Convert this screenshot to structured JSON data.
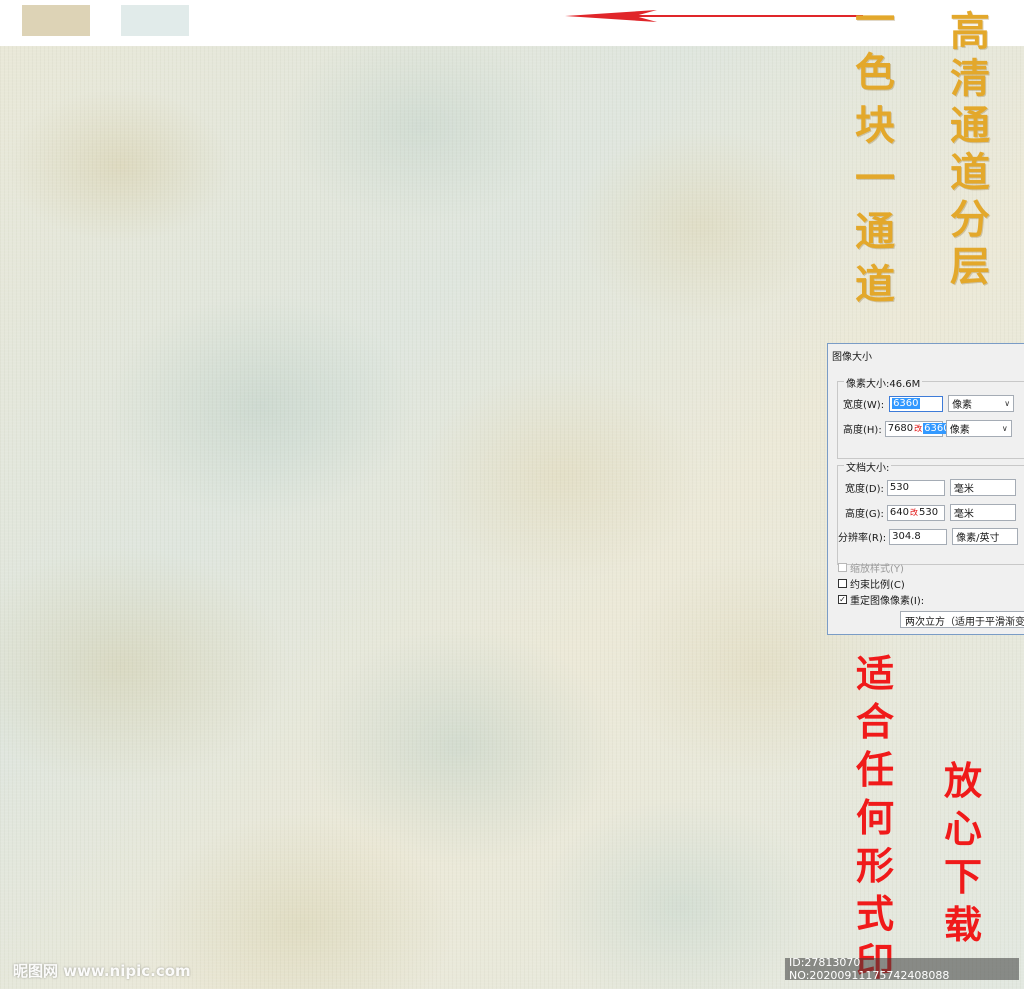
{
  "swatches": {
    "color_1": "#ddd3b6",
    "color_2": "#e1ebea"
  },
  "arrow": {
    "color": "#e0262a",
    "icon": "arrow-left-icon"
  },
  "annotations": {
    "gold_left": [
      "一",
      "色",
      "块",
      "一",
      "通",
      "道"
    ],
    "gold_right": [
      "高",
      "清",
      "通",
      "道",
      "分",
      "层"
    ],
    "red_left": [
      "适",
      "合",
      "任",
      "何",
      "形",
      "式",
      "印"
    ],
    "red_right": [
      "放",
      "心",
      "下",
      "载"
    ]
  },
  "dialog": {
    "title": "图像大小",
    "pixel_dimensions": {
      "legend": "像素大小:46.6M",
      "width_label": "宽度(W):",
      "width_value": "6360",
      "width_unit": "像素",
      "height_label": "高度(H):",
      "height_value_old": "7680",
      "height_mark": "改",
      "height_value_new": "6360",
      "height_unit": "像素"
    },
    "document_size": {
      "legend": "文档大小:",
      "width_label": "宽度(D):",
      "width_value": "530",
      "width_unit": "毫米",
      "height_label": "高度(G):",
      "height_value_old": "640",
      "height_mark": "改",
      "height_value_new": "530",
      "height_unit": "毫米",
      "resolution_label": "分辨率(R):",
      "resolution_value": "304.8",
      "resolution_unit": "像素/英寸"
    },
    "options": {
      "scale_styles": "缩放样式(Y)",
      "constrain_proportions": "约束比例(C)",
      "resample": "重定图像像素(I):",
      "resample_method": "两次立方（适用于平滑渐变"
    }
  },
  "watermark": {
    "site": "昵图网 www.nipic.com",
    "id_text": "ID:27813070 NO:20200911175742408088"
  }
}
